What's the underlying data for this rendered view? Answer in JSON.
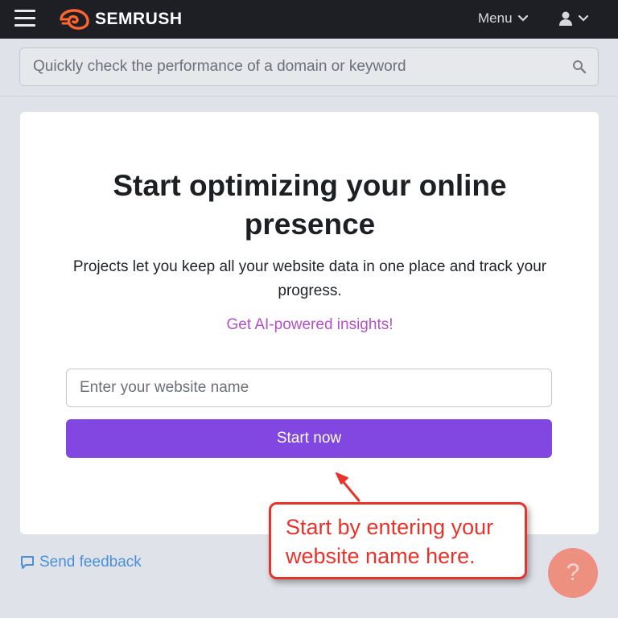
{
  "header": {
    "brand": "SEMRUSH",
    "menu_label": "Menu",
    "icons": {
      "menu": "hamburger-icon",
      "logo": "semrush-fire-logo",
      "user": "user-icon",
      "chevron": "chevron-down-icon"
    },
    "colors": {
      "bar": "#1d1f24",
      "logo_accent": "#ff642d"
    }
  },
  "search": {
    "placeholder": "Quickly check the performance of a domain or keyword",
    "icon": "search-icon"
  },
  "card": {
    "title": "Start optimizing your online presence",
    "subtitle": "Projects let you keep all your website data in one place and track your progress.",
    "ai_link": "Get AI-powered insights!",
    "website_input_placeholder": "Enter your website name",
    "start_button": "Start now",
    "colors": {
      "button": "#8147e0",
      "ai_link": "#b550c8"
    }
  },
  "feedback": {
    "label": "Send feedback",
    "icon": "chat-bubble-icon"
  },
  "annotation": {
    "line1": "Start by entering your",
    "line2": "website name here.",
    "color": "#e8332a"
  },
  "help": {
    "label": "?",
    "icon": "help-icon"
  }
}
